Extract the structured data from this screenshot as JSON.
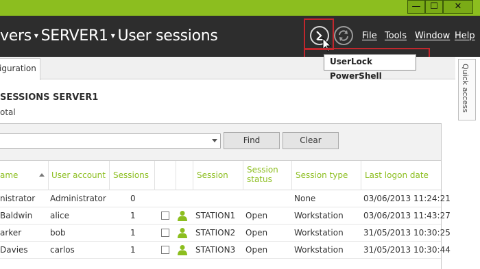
{
  "window": {
    "minimize_glyph": "—",
    "maximize_glyph": "☐",
    "close_glyph": "✕"
  },
  "header": {
    "breadcrumb": [
      "vers",
      "SERVER1",
      "User sessions"
    ],
    "breadcrumb_sep": "▾",
    "powershell_icon": "powershell-icon",
    "refresh_icon": "refresh-icon",
    "menu": {
      "file": "File",
      "tools": "Tools",
      "window": "Window",
      "help": "Help"
    }
  },
  "tooltip": {
    "text": "UserLock PowerShell"
  },
  "highlight_color": "#c1272d",
  "accent_color": "#8cbe1f",
  "tabs": {
    "active": "iguration"
  },
  "quick_access": {
    "label": "Quick access"
  },
  "section": {
    "title": "SESSIONS  SERVER1",
    "subtitle": "otal"
  },
  "toolbar": {
    "search_value": "",
    "find_label": "Find",
    "clear_label": "Clear"
  },
  "grid": {
    "headers": {
      "name": "ame",
      "user_account": "User account",
      "sessions": "Sessions",
      "session": "Session",
      "session_status_1": "Session",
      "session_status_2": "status",
      "session_type": "Session type",
      "last_logon": "Last logon date"
    },
    "rows": [
      {
        "name": "nistrator",
        "account": "Administrator",
        "sessions": "0",
        "has_session": false,
        "session": "",
        "status": "",
        "type": "None",
        "last_logon": "03/06/2013 11:24:21"
      },
      {
        "name": "Baldwin",
        "account": "alice",
        "sessions": "1",
        "has_session": true,
        "session": "STATION1",
        "status": "Open",
        "type": "Workstation",
        "last_logon": "03/06/2013 11:43:27"
      },
      {
        "name": "arker",
        "account": "bob",
        "sessions": "1",
        "has_session": true,
        "session": "STATION2",
        "status": "Open",
        "type": "Workstation",
        "last_logon": "31/05/2013 10:30:25"
      },
      {
        "name": " Davies",
        "account": "carlos",
        "sessions": "1",
        "has_session": true,
        "session": "STATION3",
        "status": "Open",
        "type": "Workstation",
        "last_logon": "31/05/2013 10:30:44"
      }
    ]
  }
}
